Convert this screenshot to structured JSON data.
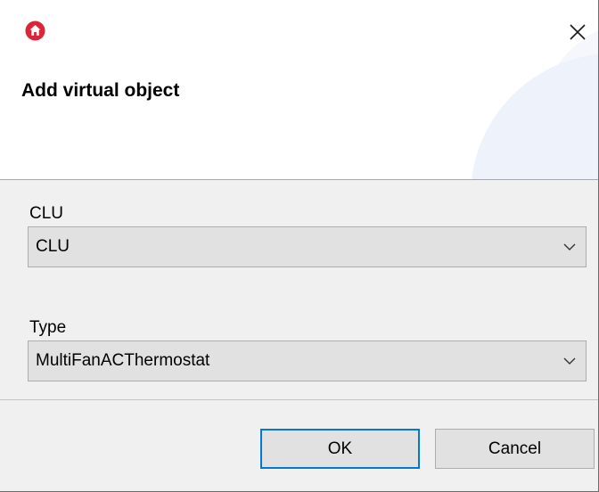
{
  "dialog": {
    "title": "Add virtual object",
    "app_icon": "home-icon",
    "close_icon": "close-icon",
    "accent_color": "#d9263a"
  },
  "fields": {
    "clu": {
      "label": "CLU",
      "value": "CLU"
    },
    "type": {
      "label": "Type",
      "value": "MultiFanACThermostat"
    }
  },
  "buttons": {
    "ok_label": "OK",
    "cancel_label": "Cancel",
    "focus_color": "#0078d7"
  }
}
